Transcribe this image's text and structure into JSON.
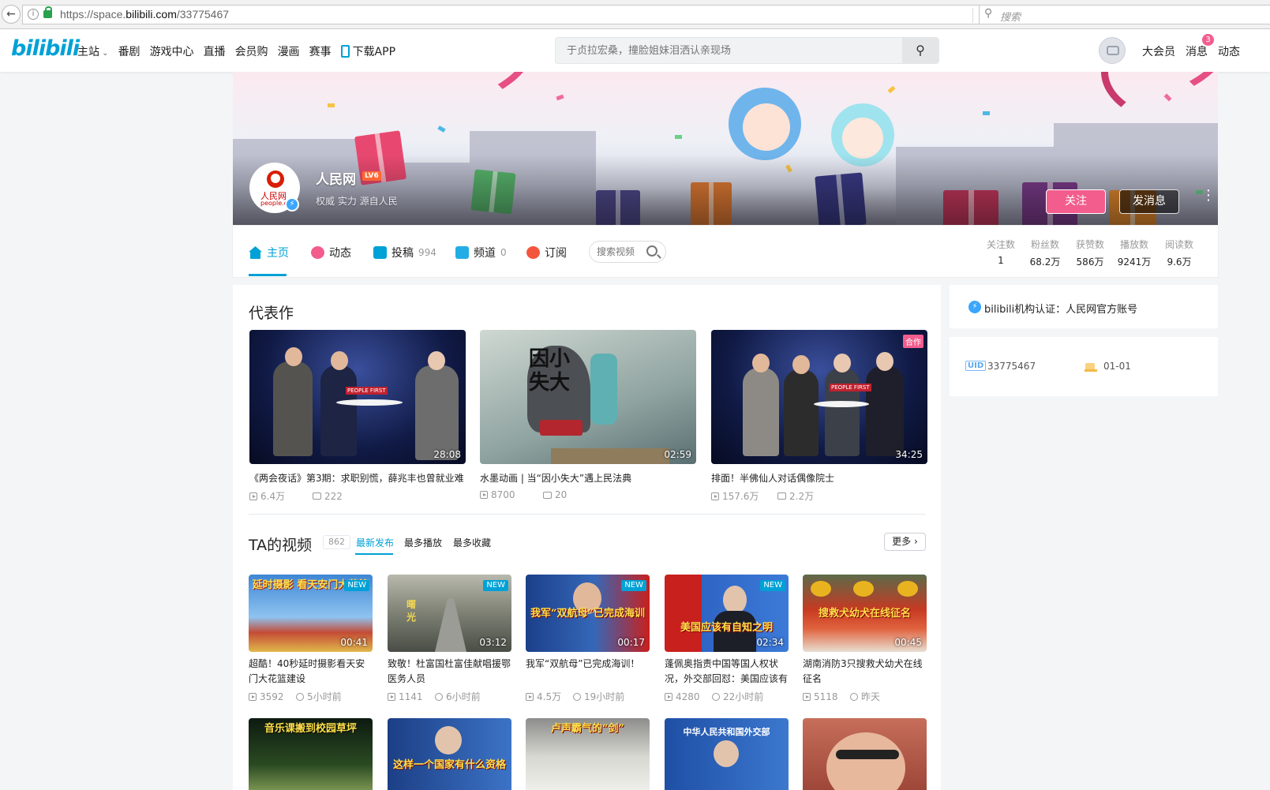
{
  "browser": {
    "url_prefix": "https://space.",
    "url_domain": "bilibili.com",
    "url_path": "/33775467",
    "search_placeholder": "搜索"
  },
  "header": {
    "logo": "bilibili",
    "nav": [
      "主站",
      "番剧",
      "游戏中心",
      "直播",
      "会员购",
      "漫画",
      "赛事",
      "下载APP"
    ],
    "search_placeholder": "于贞拉宏桑，撞脸姐妹泪洒认亲现场",
    "user_links": [
      "大会员",
      "消息",
      "动态"
    ],
    "message_badge": "3"
  },
  "profile": {
    "name": "人民网",
    "level": "LV6",
    "sign": "权威 实力 源自人民",
    "avatar_text": "人民网",
    "avatar_text2": "people.c",
    "follow_label": "关注",
    "message_label": "发消息",
    "more": "⋮"
  },
  "tabs": [
    {
      "label": "主页",
      "count": ""
    },
    {
      "label": "动态",
      "count": ""
    },
    {
      "label": "投稿",
      "count": "994"
    },
    {
      "label": "频道",
      "count": "0"
    },
    {
      "label": "订阅",
      "count": ""
    }
  ],
  "space_search_placeholder": "搜索视频",
  "stats": [
    {
      "label": "关注数",
      "value": "1"
    },
    {
      "label": "粉丝数",
      "value": "68.2万"
    },
    {
      "label": "获赞数",
      "value": "586万"
    },
    {
      "label": "播放数",
      "value": "9241万"
    },
    {
      "label": "阅读数",
      "value": "9.6万"
    }
  ],
  "masterpiece": {
    "title": "代表作",
    "items": [
      {
        "duration": "28:08",
        "title": "《两会夜话》第3期：求职别慌，薛兆丰也曾就业难",
        "plays": "6.4万",
        "danmaku": "222",
        "tag": "",
        "caption": "PEOPLE FIRST"
      },
      {
        "duration": "02:59",
        "title": "水墨动画 | 当“因小失大”遇上民法典",
        "plays": "8700",
        "danmaku": "20",
        "tag": "",
        "caption": "因小失大"
      },
      {
        "duration": "34:25",
        "title": "排面！半佛仙人对话偶像院士",
        "plays": "157.6万",
        "danmaku": "2.2万",
        "tag": "合作",
        "caption": "PEOPLE FIRST"
      }
    ]
  },
  "videos": {
    "title": "TA的视频",
    "count": "862",
    "sorts": [
      "最新发布",
      "最多播放",
      "最多收藏"
    ],
    "more": "更多",
    "items": [
      {
        "caption": "延时摄影 看天安门大花篮",
        "new": "NEW",
        "duration": "00:41",
        "title": "超酷！40秒延时摄影看天安门大花篮建设",
        "plays": "3592",
        "time": "5小时前"
      },
      {
        "caption": "曙光",
        "new": "NEW",
        "duration": "03:12",
        "title": "致敬！杜富国杜富佳献唱援鄂医务人员",
        "plays": "1141",
        "time": "6小时前"
      },
      {
        "caption": "我军“双航母”已完成海训",
        "new": "NEW",
        "duration": "00:17",
        "title": "我军“双航母”已完成海训！",
        "plays": "4.5万",
        "time": "19小时前"
      },
      {
        "caption": "美国应该有自知之明",
        "new": "NEW",
        "duration": "02:34",
        "title": "蓬佩奥指责中国等国人权状况，外交部回怼：美国应该有",
        "plays": "4280",
        "time": "22小时前"
      },
      {
        "caption": "搜救犬幼犬在线征名",
        "new": "",
        "duration": "00:45",
        "title": "湖南消防3只搜救犬幼犬在线征名",
        "plays": "5118",
        "time": "昨天"
      },
      {
        "caption": "音乐课搬到校园草坪"
      },
      {
        "caption": "这样一个国家有什么资格"
      },
      {
        "caption": "卢声霸气的“剑”"
      },
      {
        "caption": "中华人民共和国外交部"
      },
      {
        "caption": ""
      }
    ]
  },
  "side": {
    "auth": "bilibili机构认证：人民网官方账号",
    "uid_tag": "UID",
    "uid": "33775467",
    "birthday": "01-01"
  },
  "colors": {
    "accent": "#00a1d6",
    "pink": "#f25d8e"
  }
}
